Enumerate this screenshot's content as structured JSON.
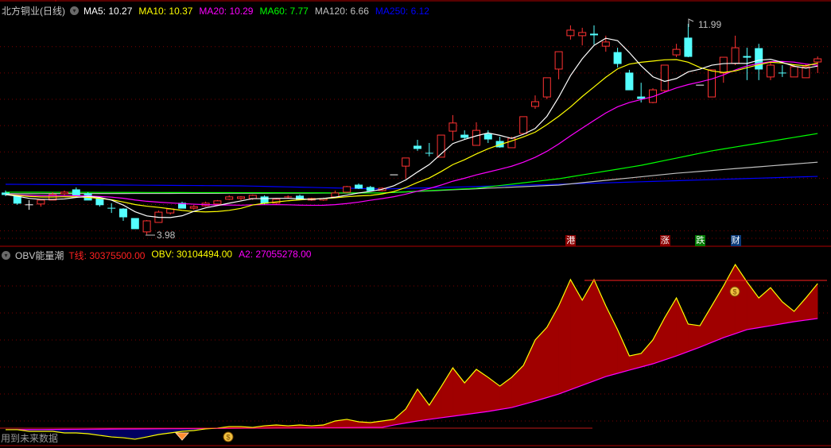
{
  "header": {
    "title": "北方铜业(日线)",
    "ma": [
      {
        "label": "MA5: 10.27",
        "color": "#ffffff"
      },
      {
        "label": "MA10: 10.37",
        "color": "#ffff00"
      },
      {
        "label": "MA20: 10.29",
        "color": "#ff00ff"
      },
      {
        "label": "MA60: 7.77",
        "color": "#00ff00"
      },
      {
        "label": "MA120: 6.66",
        "color": "#c0c0c0"
      },
      {
        "label": "MA250: 6.12",
        "color": "#0000ff"
      }
    ]
  },
  "indicator": {
    "name": "OBV能量潮",
    "items": [
      {
        "label": "T线: 30375500.00",
        "color": "#ff2020"
      },
      {
        "label": "OBV: 30104494.00",
        "color": "#ffff00"
      },
      {
        "label": "A2: 27055278.00",
        "color": "#ff00ff"
      }
    ],
    "future_data_note": "用到未来数据"
  },
  "event_tags": [
    {
      "text": "港",
      "bar": 48,
      "color": "#8b0000"
    },
    {
      "text": "涨",
      "bar": 56,
      "color": "#8b0000"
    },
    {
      "text": "跌",
      "bar": 59,
      "color": "#007a00"
    },
    {
      "text": "财",
      "bar": 62,
      "color": "#0a3a7a"
    }
  ],
  "colors": {
    "up": "#ff3232",
    "down": "#54ffff",
    "grid": "#7a0000",
    "border": "#b00000"
  },
  "chart_data": {
    "type": "candlestick",
    "high_label": "11.99",
    "low_label": "3.98",
    "candles": [
      [
        5.56,
        5.5,
        5.65,
        5.44
      ],
      [
        5.47,
        5.17,
        5.47,
        5.11
      ],
      [
        5.11,
        5.11,
        5.29,
        4.92
      ],
      [
        5.14,
        5.29,
        5.29,
        5.04
      ],
      [
        5.29,
        5.5,
        5.59,
        5.29
      ],
      [
        5.53,
        5.59,
        5.65,
        5.47
      ],
      [
        5.68,
        5.47,
        5.77,
        5.41
      ],
      [
        5.53,
        5.29,
        5.59,
        5.29
      ],
      [
        5.35,
        5.11,
        5.35,
        5.04
      ],
      [
        4.98,
        4.98,
        5.17,
        4.8
      ],
      [
        4.95,
        4.65,
        4.98,
        4.5
      ],
      [
        4.59,
        4.2,
        4.59,
        4.2
      ],
      [
        4.08,
        4.5,
        4.53,
        3.98
      ],
      [
        4.44,
        4.83,
        4.89,
        4.44
      ],
      [
        4.8,
        4.95,
        4.98,
        4.74
      ],
      [
        5.17,
        4.98,
        5.23,
        4.98
      ],
      [
        4.98,
        5.04,
        5.11,
        4.92
      ],
      [
        5.07,
        5.17,
        5.23,
        5.04
      ],
      [
        5.14,
        5.26,
        5.29,
        5.11
      ],
      [
        5.32,
        5.41,
        5.47,
        5.29
      ],
      [
        5.35,
        5.41,
        5.44,
        5.29
      ],
      [
        5.35,
        5.47,
        5.5,
        5.29
      ],
      [
        5.41,
        5.17,
        5.47,
        5.11
      ],
      [
        5.17,
        5.32,
        5.35,
        5.14
      ],
      [
        5.41,
        5.41,
        5.47,
        5.35
      ],
      [
        5.44,
        5.32,
        5.5,
        5.29
      ],
      [
        5.29,
        5.35,
        5.38,
        5.26
      ],
      [
        5.29,
        5.35,
        5.38,
        5.26
      ],
      [
        5.41,
        5.56,
        5.65,
        5.38
      ],
      [
        5.59,
        5.8,
        5.83,
        5.56
      ],
      [
        5.86,
        5.74,
        5.92,
        5.71
      ],
      [
        5.77,
        5.65,
        5.83,
        5.65
      ],
      [
        5.65,
        5.74,
        5.77,
        5.62
      ],
      [
        6.25,
        6.25,
        6.25,
        6.25
      ],
      [
        6.58,
        6.89,
        6.89,
        6.1
      ],
      [
        7.34,
        7.25,
        7.58,
        7.16
      ],
      [
        7.07,
        7.07,
        7.46,
        6.95
      ],
      [
        6.92,
        7.76,
        7.76,
        6.92
      ],
      [
        7.91,
        8.22,
        8.52,
        7.55
      ],
      [
        7.76,
        7.67,
        7.94,
        7.61
      ],
      [
        7.37,
        7.94,
        8.25,
        7.37
      ],
      [
        7.79,
        7.61,
        7.94,
        7.46
      ],
      [
        7.52,
        7.31,
        7.7,
        7.28
      ],
      [
        7.28,
        7.64,
        7.7,
        7.28
      ],
      [
        7.82,
        8.46,
        8.46,
        7.82
      ],
      [
        8.85,
        9.03,
        9.27,
        8.76
      ],
      [
        9.21,
        9.94,
        9.94,
        9.12
      ],
      [
        10.27,
        10.93,
        10.93,
        9.88
      ],
      [
        11.54,
        11.75,
        11.93,
        11.39
      ],
      [
        11.54,
        11.66,
        11.84,
        11.17
      ],
      [
        11.6,
        11.57,
        11.93,
        11.2
      ],
      [
        11.14,
        11.3,
        11.54,
        10.93
      ],
      [
        10.9,
        10.48,
        11.08,
        10.33
      ],
      [
        10.12,
        9.48,
        10.24,
        9.48
      ],
      [
        9.21,
        9.15,
        9.75,
        9.0
      ],
      [
        9.0,
        9.48,
        9.54,
        8.97
      ],
      [
        9.45,
        10.42,
        10.42,
        9.39
      ],
      [
        10.81,
        11.02,
        11.23,
        10.72
      ],
      [
        11.45,
        10.75,
        11.99,
        10.72
      ],
      [
        9.66,
        9.66,
        9.66,
        9.66
      ],
      [
        9.21,
        10.24,
        10.24,
        9.21
      ],
      [
        10.12,
        10.72,
        10.72,
        9.75
      ],
      [
        10.48,
        11.08,
        11.54,
        10.42
      ],
      [
        10.75,
        10.72,
        11.08,
        9.85
      ],
      [
        11.05,
        10.27,
        11.23,
        9.85
      ],
      [
        9.97,
        10.42,
        10.54,
        9.85
      ],
      [
        10.12,
        10.12,
        10.42,
        9.97
      ],
      [
        9.97,
        10.36,
        10.42,
        9.97
      ],
      [
        9.94,
        10.36,
        10.48,
        9.94
      ],
      [
        10.54,
        10.66,
        10.75,
        10.12
      ]
    ],
    "long_ma_anchors": {
      "MA60": [
        [
          0,
          5.59
        ],
        [
          32,
          5.56
        ],
        [
          40,
          5.74
        ],
        [
          47,
          6.1
        ],
        [
          54,
          6.61
        ],
        [
          60,
          7.16
        ],
        [
          69,
          7.82
        ]
      ],
      "MA120": [
        [
          0,
          5.53
        ],
        [
          32,
          5.56
        ],
        [
          47,
          5.86
        ],
        [
          57,
          6.31
        ],
        [
          69,
          6.73
        ]
      ],
      "MA250": [
        [
          0,
          5.89
        ],
        [
          20,
          5.83
        ],
        [
          32,
          5.71
        ],
        [
          47,
          5.89
        ],
        [
          69,
          6.19
        ]
      ]
    },
    "obv_millions": [
      17.37,
      17.37,
      17.23,
      17.23,
      17.23,
      17.09,
      17.09,
      17.02,
      16.88,
      16.74,
      16.67,
      16.54,
      16.74,
      16.95,
      17.09,
      17.23,
      17.3,
      17.44,
      17.51,
      17.64,
      17.64,
      17.57,
      17.71,
      17.78,
      17.71,
      17.78,
      17.71,
      17.78,
      18.13,
      18.27,
      18.06,
      17.99,
      18.13,
      18.27,
      19.17,
      20.9,
      19.51,
      21.1,
      22.76,
      21.45,
      22.63,
      21.93,
      21.17,
      21.93,
      22.97,
      25.19,
      26.29,
      28.16,
      30.45,
      28.65,
      30.45,
      28.16,
      26.09,
      23.8,
      24.01,
      25.19,
      27.12,
      28.85,
      26.57,
      26.43,
      28.16,
      29.89,
      31.76,
      30.24,
      28.85,
      29.75,
      28.51,
      27.68,
      28.85,
      30.1
    ],
    "a2_anchors_millions": [
      [
        0,
        17.37
      ],
      [
        32,
        17.57
      ],
      [
        33,
        17.78
      ],
      [
        35,
        18.13
      ],
      [
        37,
        18.41
      ],
      [
        39,
        18.68
      ],
      [
        41,
        18.96
      ],
      [
        43,
        19.3
      ],
      [
        45,
        19.86
      ],
      [
        47,
        20.48
      ],
      [
        49,
        21.24
      ],
      [
        51,
        22.0
      ],
      [
        53,
        22.56
      ],
      [
        55,
        23.11
      ],
      [
        57,
        23.8
      ],
      [
        59,
        24.56
      ],
      [
        61,
        25.39
      ],
      [
        63,
        26.09
      ],
      [
        65,
        26.43
      ],
      [
        67,
        26.78
      ],
      [
        69,
        27.06
      ]
    ],
    "t_line_millions": 30.3755
  }
}
